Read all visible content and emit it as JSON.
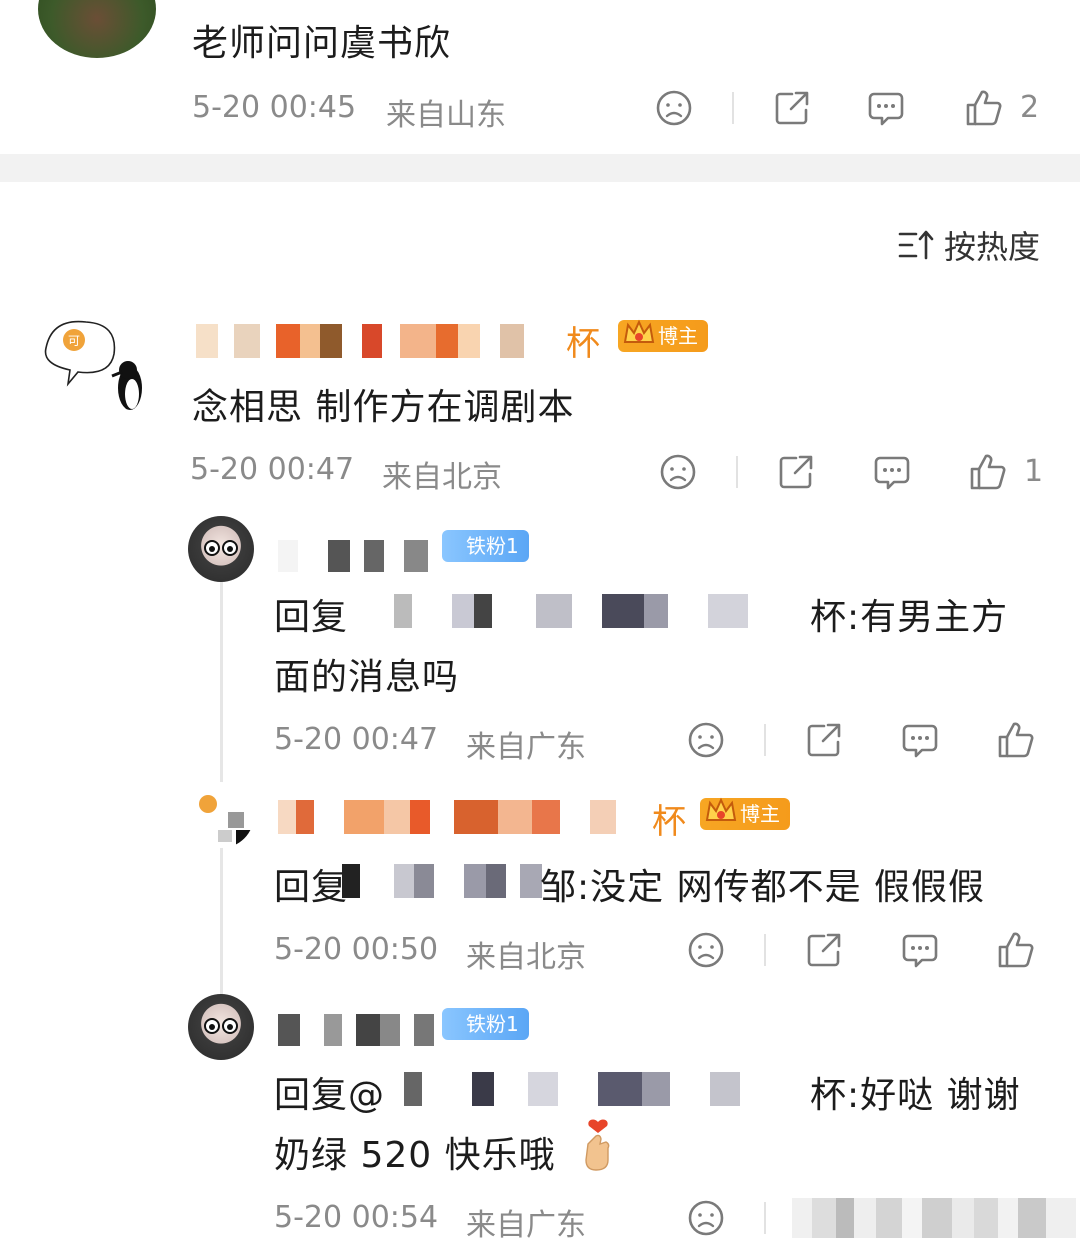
{
  "top_comment": {
    "text": "老师问问虞书欣",
    "time": "5-20 00:45",
    "location": "来自山东",
    "likes": "2"
  },
  "sort": {
    "label": "按热度"
  },
  "comment_main": {
    "name_tail": "杯",
    "badge": "博主",
    "text": "念相思 制作方在调剧本",
    "time": "5-20 00:47",
    "location": "来自北京",
    "likes": "1"
  },
  "replies": [
    {
      "badge": "铁粉1",
      "text_prefix": "回复",
      "text_mid": "杯:有男主方",
      "text_line2": "面的消息吗",
      "time": "5-20 00:47",
      "location": "来自广东"
    },
    {
      "name_tail": "杯",
      "badge": "博主",
      "text_prefix": "回复",
      "text_mid": "邹:没定 网传都不是 假假假",
      "time": "5-20 00:50",
      "location": "来自北京"
    },
    {
      "badge": "铁粉1",
      "text_prefix": "回复@",
      "text_mid": "杯:好哒 谢谢",
      "text_line2": "奶绿 520 快乐哦",
      "time": "5-20 00:54",
      "location": "来自广东"
    }
  ],
  "colors": {
    "meta_gray": "#8a8a8a",
    "blogger_badge": "#f7a623",
    "fan_badge": "#5aa6f5",
    "divider": "#f2f2f2"
  },
  "icons": [
    "sad-face-icon",
    "share-icon",
    "comment-icon",
    "thumbs-up-icon",
    "sort-icon",
    "heart-hand-emoji"
  ]
}
